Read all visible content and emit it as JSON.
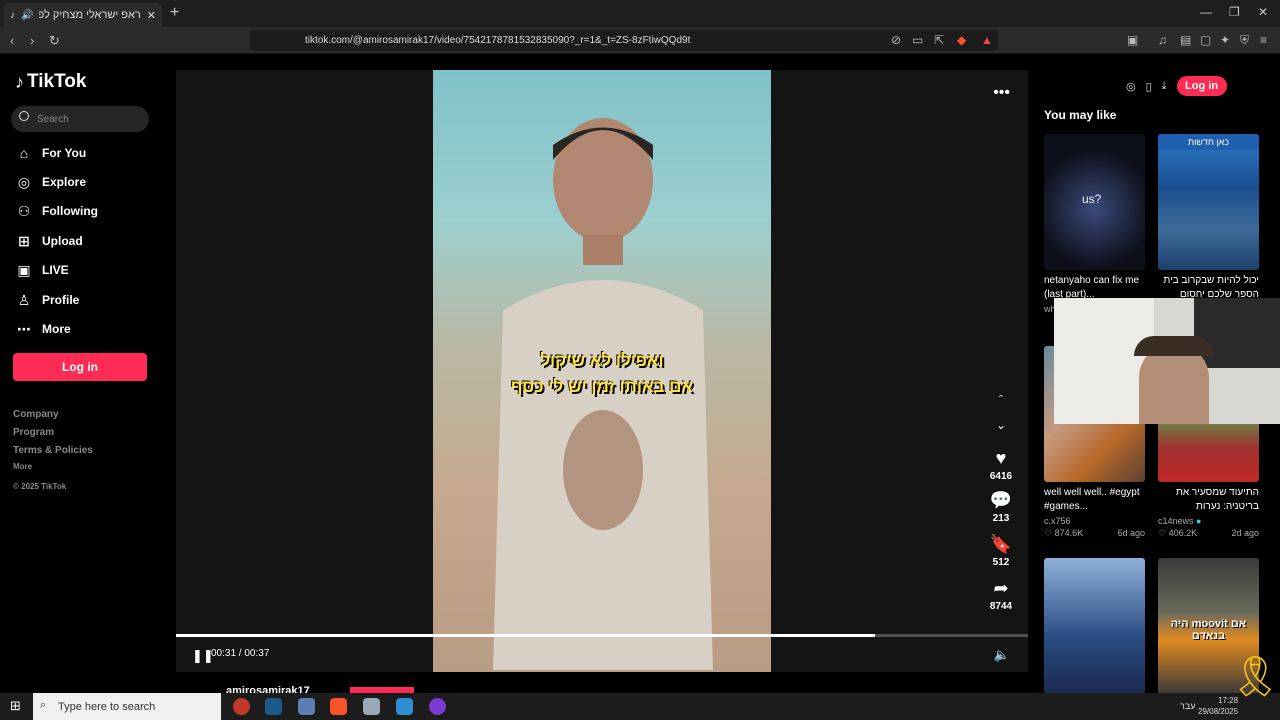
{
  "browser": {
    "tab_title": "ראפ ישראלי מצחיק לפני השי",
    "url": "tiktok.com/@amirosamirak17/video/7542178781532835090?_r=1&_t=ZS-8zFtiwQQd9t"
  },
  "sidebar": {
    "logo": "TikTok",
    "search_placeholder": "Search",
    "nav": [
      {
        "label": "For You",
        "icon": "home-icon"
      },
      {
        "label": "Explore",
        "icon": "compass-icon"
      },
      {
        "label": "Following",
        "icon": "user-icon"
      },
      {
        "label": "Upload",
        "icon": "plus-square-icon"
      },
      {
        "label": "LIVE",
        "icon": "tv-icon"
      },
      {
        "label": "Profile",
        "icon": "profile-icon"
      },
      {
        "label": "More",
        "icon": "dots-icon"
      }
    ],
    "login": "Log in",
    "footer": {
      "company": "Company",
      "program": "Program",
      "terms": "Terms & Policies",
      "more": "More",
      "copyright": "© 2025 TikTok"
    }
  },
  "video": {
    "caption_line1": "ואפילו לא שיקול",
    "caption_line2": "אם באותו זמן יש לי כסף",
    "time": "00:31 / 00:37",
    "progress": 0.82,
    "likes": "6416",
    "comments": "213",
    "saves": "512",
    "shares": "8744",
    "author": "amirosamirak17"
  },
  "right": {
    "login": "Log in",
    "you_may_like": "You may like",
    "cards": [
      {
        "title": "netanyaho can fix me (last part)...",
        "author": "wh",
        "likes": "",
        "age": ""
      },
      {
        "title": "יכול להיות שבקרוב בית הספר שלכם יחסום לכם...",
        "author": "",
        "likes": "",
        "age": ""
      },
      {
        "title": "well well well.. #egypt #games...",
        "author": "c.x756",
        "likes": "874.6K",
        "age": "6d ago"
      },
      {
        "title": "התיעוד שמסעיר את בריטניה: נערות נאלצות...",
        "author": "c14news",
        "likes": "406.2K",
        "age": "2d ago"
      }
    ],
    "thumb_overlay_us": "us?",
    "thumb_overlay_moovit": "אם moovit היה בנאדם",
    "thumb_overlay_kan": "כאן חדשות"
  },
  "taskbar": {
    "search_placeholder": "Type here to search",
    "lang": "עבר",
    "time": "17:28",
    "date": "29/08/2025"
  }
}
